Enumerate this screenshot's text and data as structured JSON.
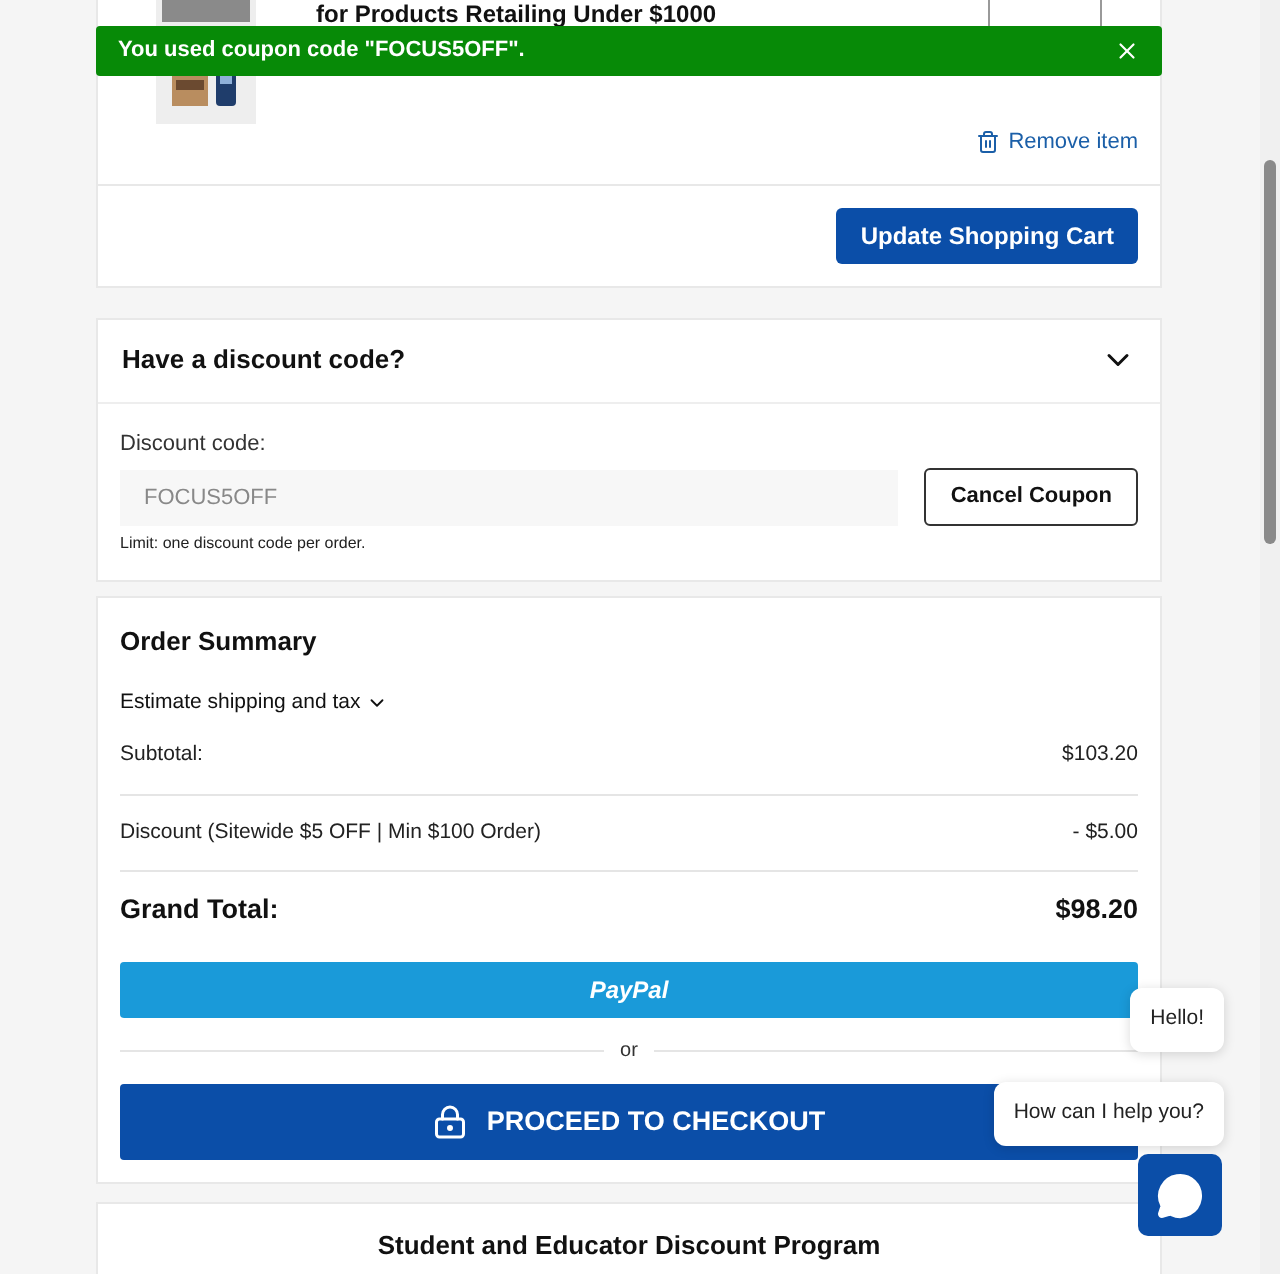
{
  "toast": {
    "message": "You used coupon code \"FOCUS5OFF\"."
  },
  "cart_item": {
    "title": "for Products Retailing Under $1000",
    "remove_label": "Remove item"
  },
  "update_button": "Update Shopping Cart",
  "discount": {
    "title": "Have a discount code?",
    "expanded": true,
    "field_label": "Discount code:",
    "placeholder": "FOCUS5OFF",
    "button": "Cancel Coupon",
    "note": "Limit: one discount code per order."
  },
  "summary": {
    "title": "Order Summary",
    "estimate_label": "Estimate shipping and tax",
    "rows": [
      {
        "label": "Subtotal:",
        "value": "$103.20"
      },
      {
        "label": "Discount (Sitewide $5 OFF | Min $100 Order)",
        "value": "- $5.00"
      }
    ],
    "grand_total": {
      "label": "Grand Total:",
      "value": "$98.20"
    },
    "paypal": "PayPal",
    "or": "or",
    "checkout": "PROCEED TO CHECKOUT"
  },
  "next_section": {
    "title": "Student and Educator Discount Program"
  },
  "chat": {
    "bubbles": [
      "Hello!",
      "How can I help you?"
    ]
  }
}
